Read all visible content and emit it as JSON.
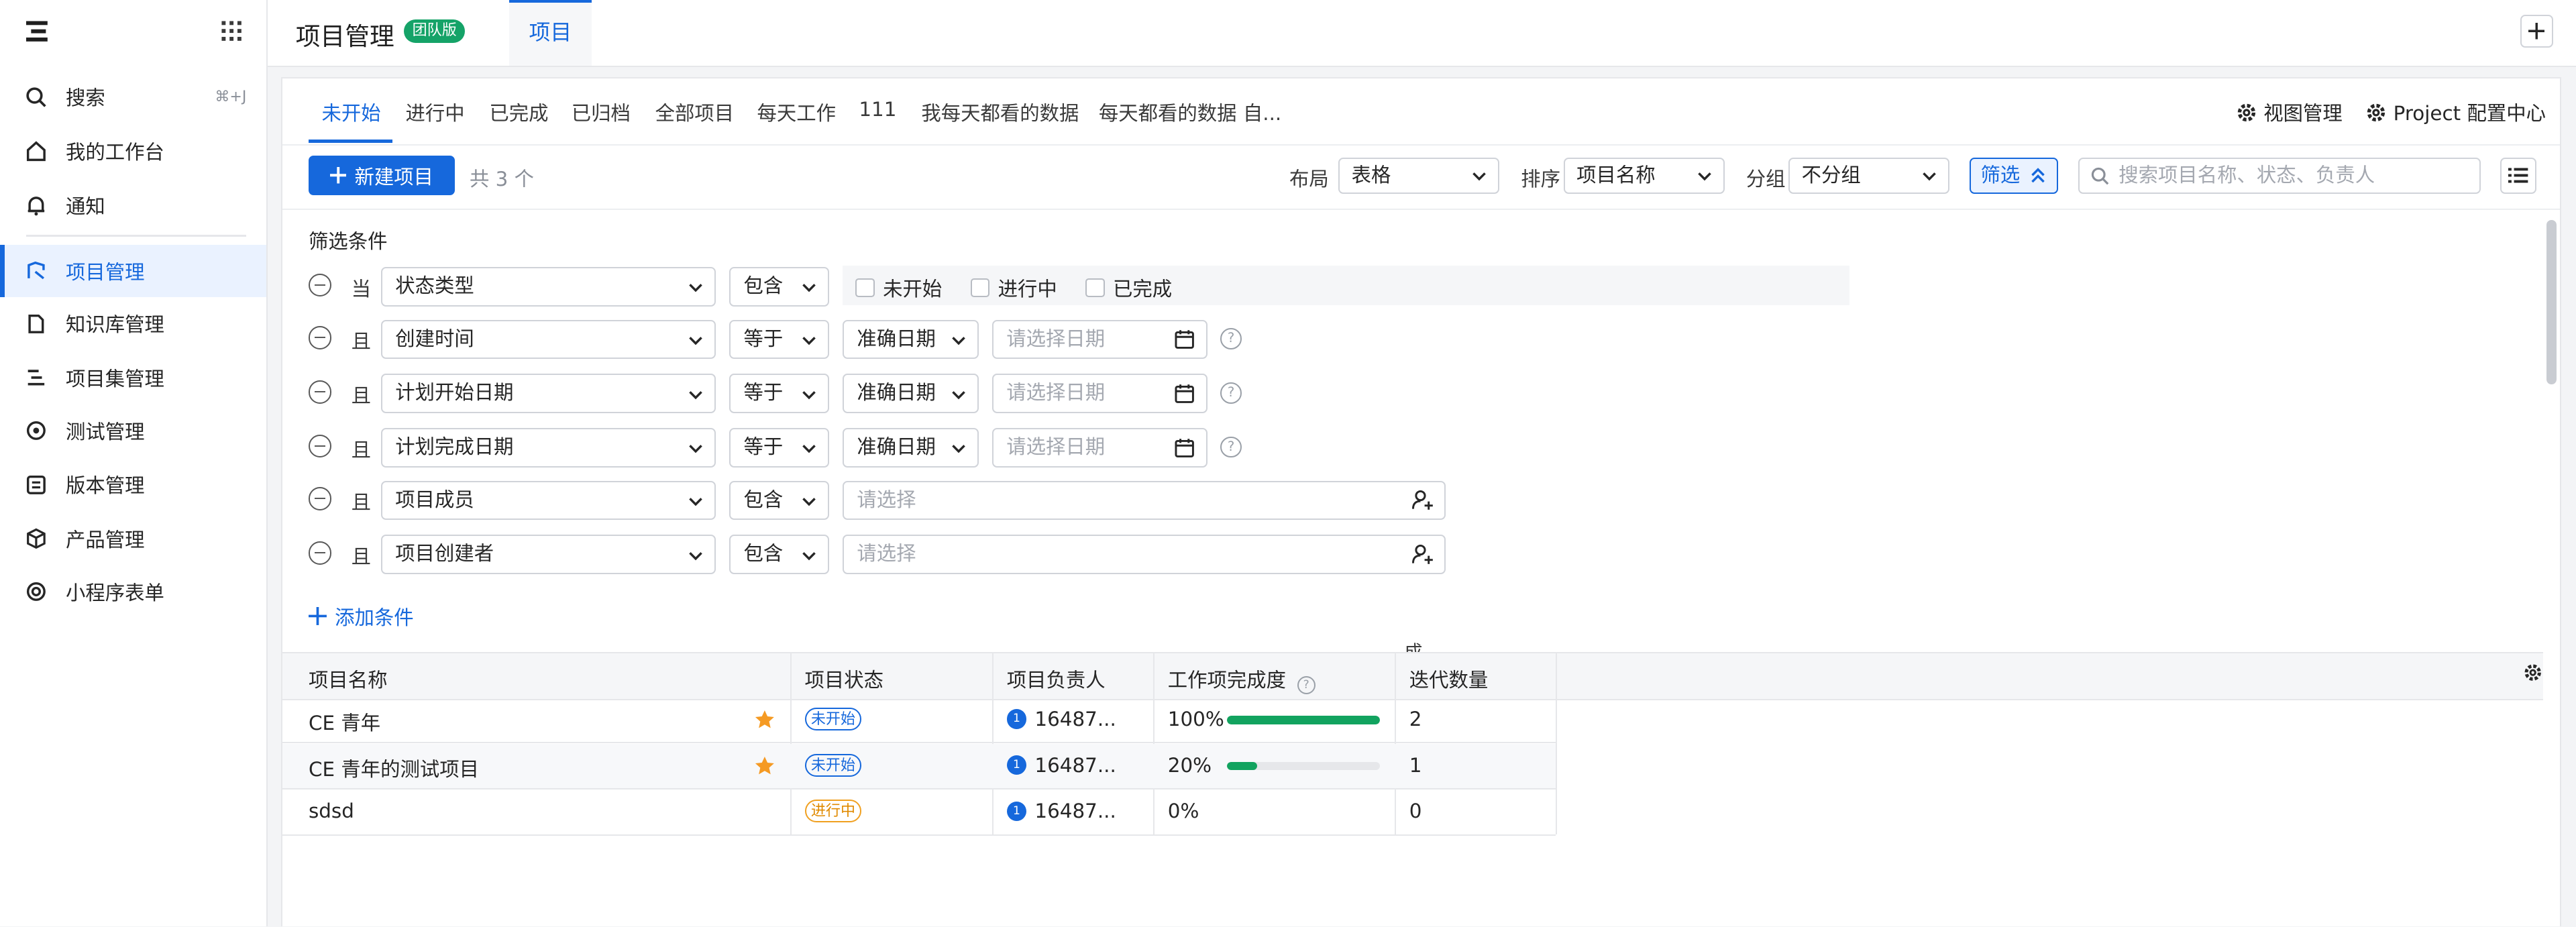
{
  "sidebar": {
    "items": [
      {
        "label": "搜索",
        "shortcut": "⌘+J",
        "icon": "search-icon"
      },
      {
        "label": "我的工作台",
        "icon": "home-icon"
      },
      {
        "label": "通知",
        "icon": "bell-icon"
      },
      {
        "label": "项目管理",
        "icon": "project-icon",
        "active": true
      },
      {
        "label": "知识库管理",
        "icon": "document-icon"
      },
      {
        "label": "项目集管理",
        "icon": "program-icon"
      },
      {
        "label": "测试管理",
        "icon": "test-icon"
      },
      {
        "label": "版本管理",
        "icon": "version-icon"
      },
      {
        "label": "产品管理",
        "icon": "cube-icon"
      },
      {
        "label": "小程序表单",
        "icon": "form-icon"
      }
    ]
  },
  "header": {
    "title": "项目管理",
    "badge": "团队版",
    "tab": "项目"
  },
  "tabs": [
    "未开始",
    "进行中",
    "已完成",
    "已归档",
    "全部项目",
    "每天工作",
    "111",
    "我每天都看的数据",
    "每天都看的数据 自..."
  ],
  "view_actions": {
    "views": "视图管理",
    "config": "Project 配置中心"
  },
  "toolbar": {
    "new_button": "新建项目",
    "count": "共 3 个",
    "layout_label": "布局",
    "layout_value": "表格",
    "sort_label": "排序",
    "sort_value": "项目名称",
    "group_label": "分组",
    "group_value": "不分组",
    "filter_button": "筛选",
    "search_placeholder": "搜索项目名称、状态、负责人"
  },
  "filters": {
    "title": "筛选条件",
    "rows": [
      {
        "conj": "当",
        "field": "状态类型",
        "op": "包含",
        "options": [
          "未开始",
          "进行中",
          "已完成"
        ]
      },
      {
        "conj": "且",
        "field": "创建时间",
        "op": "等于",
        "mode": "准确日期",
        "placeholder": "请选择日期"
      },
      {
        "conj": "且",
        "field": "计划开始日期",
        "op": "等于",
        "mode": "准确日期",
        "placeholder": "请选择日期"
      },
      {
        "conj": "且",
        "field": "计划完成日期",
        "op": "等于",
        "mode": "准确日期",
        "placeholder": "请选择日期"
      },
      {
        "conj": "且",
        "field": "项目成员",
        "op": "包含",
        "placeholder": "请选择"
      },
      {
        "conj": "且",
        "field": "项目创建者",
        "op": "包含",
        "placeholder": "请选择"
      }
    ],
    "add": "添加条件"
  },
  "stray_text": "成",
  "table": {
    "columns": [
      "项目名称",
      "项目状态",
      "项目负责人",
      "工作项完成度",
      "迭代数量"
    ],
    "rows": [
      {
        "name": "CE 青年",
        "starred": true,
        "status": "未开始",
        "owner": "16487...",
        "owner_initial": "1",
        "progress": "100%",
        "progress_value": 100,
        "iterations": "2"
      },
      {
        "name": "CE 青年的测试项目",
        "starred": true,
        "status": "未开始",
        "owner": "16487...",
        "owner_initial": "1",
        "progress": "20%",
        "progress_value": 20,
        "iterations": "1"
      },
      {
        "name": "sdsd",
        "starred": false,
        "status": "进行中",
        "owner": "16487...",
        "owner_initial": "1",
        "progress": "0%",
        "progress_value": 0,
        "iterations": "0"
      }
    ]
  },
  "colors": {
    "accent": "#1668dc",
    "success": "#12a35f",
    "star": "#f59a23",
    "badge": "#15a368"
  }
}
